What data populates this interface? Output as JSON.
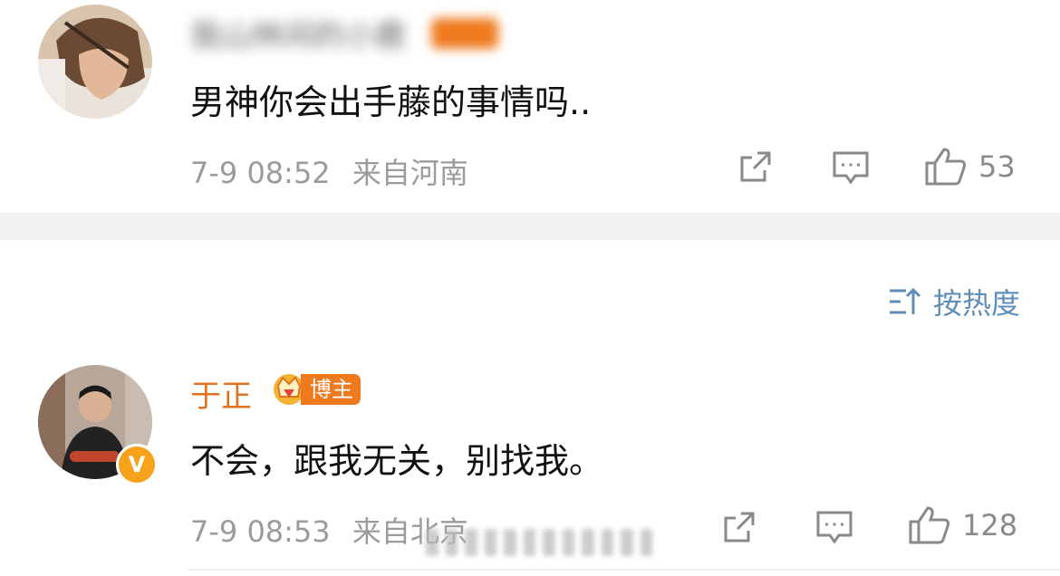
{
  "comments": [
    {
      "user_name": "我山林间的小鹿",
      "text": "男神你会出手藤的事情吗..",
      "meta_time": "7-9 08:52",
      "meta_location": "来自河南",
      "likes": "53"
    },
    {
      "user_name": "于正",
      "badge": "博主",
      "text": "不会，跟我无关，别找我。",
      "meta_time": "7-9 08:53",
      "meta_location": "来自北京",
      "likes": "128"
    }
  ],
  "sort": {
    "label": "按热度"
  },
  "colors": {
    "accent": "#5f8fb8",
    "name_orange": "#e2731f",
    "badge": "#ef7a1e",
    "meta": "#9b9b9b"
  },
  "icons": [
    "share-icon",
    "comment-icon",
    "like-icon",
    "sort-icon",
    "verified-icon",
    "crown-icon"
  ]
}
